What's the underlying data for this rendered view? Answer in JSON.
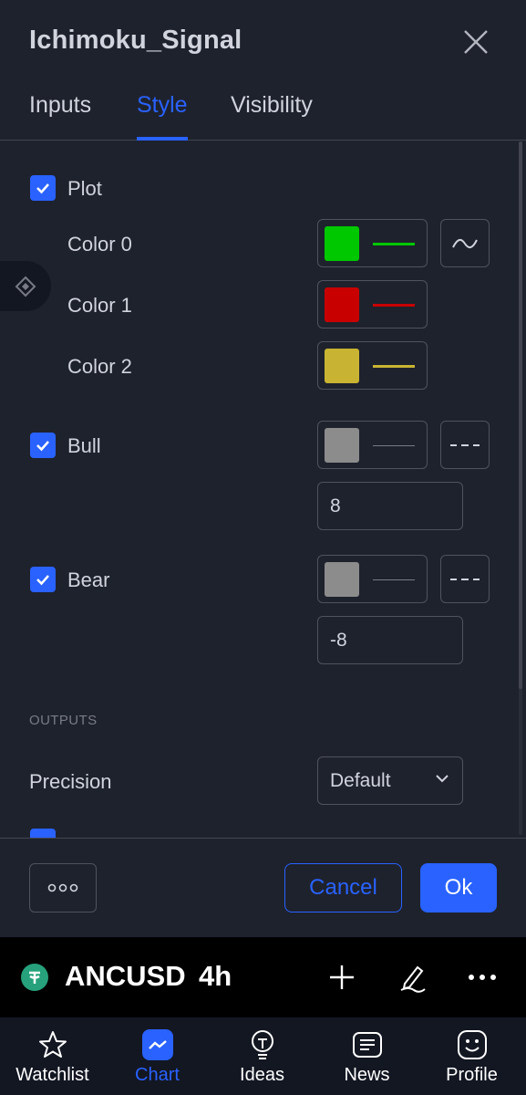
{
  "dialog": {
    "title": "Ichimoku_Signal",
    "tabs": [
      {
        "label": "Inputs"
      },
      {
        "label": "Style"
      },
      {
        "label": "Visibility"
      }
    ],
    "active_tab": "Style"
  },
  "style": {
    "plot": {
      "label": "Plot",
      "checked": true,
      "colors": [
        {
          "label": "Color 0",
          "color": "#00c800"
        },
        {
          "label": "Color 1",
          "color": "#c80000"
        },
        {
          "label": "Color 2",
          "color": "#c8b432"
        }
      ]
    },
    "bull": {
      "label": "Bull",
      "checked": true,
      "value": "8",
      "line_color": "#8c8c8c"
    },
    "bear": {
      "label": "Bear",
      "checked": true,
      "value": "-8",
      "line_color": "#8c8c8c"
    },
    "outputs": {
      "section_title": "OUTPUTS",
      "precision_label": "Precision",
      "precision_value": "Default"
    }
  },
  "footer": {
    "cancel_label": "Cancel",
    "ok_label": "Ok"
  },
  "symbol_bar": {
    "symbol": "ANCUSD",
    "interval": "4h"
  },
  "bottom_nav": [
    {
      "label": "Watchlist"
    },
    {
      "label": "Chart"
    },
    {
      "label": "Ideas"
    },
    {
      "label": "News"
    },
    {
      "label": "Profile"
    }
  ],
  "colors": {
    "accent": "#2962ff",
    "background": "#1e222d",
    "text": "#d1d4dc",
    "tether": "#26a17b"
  }
}
